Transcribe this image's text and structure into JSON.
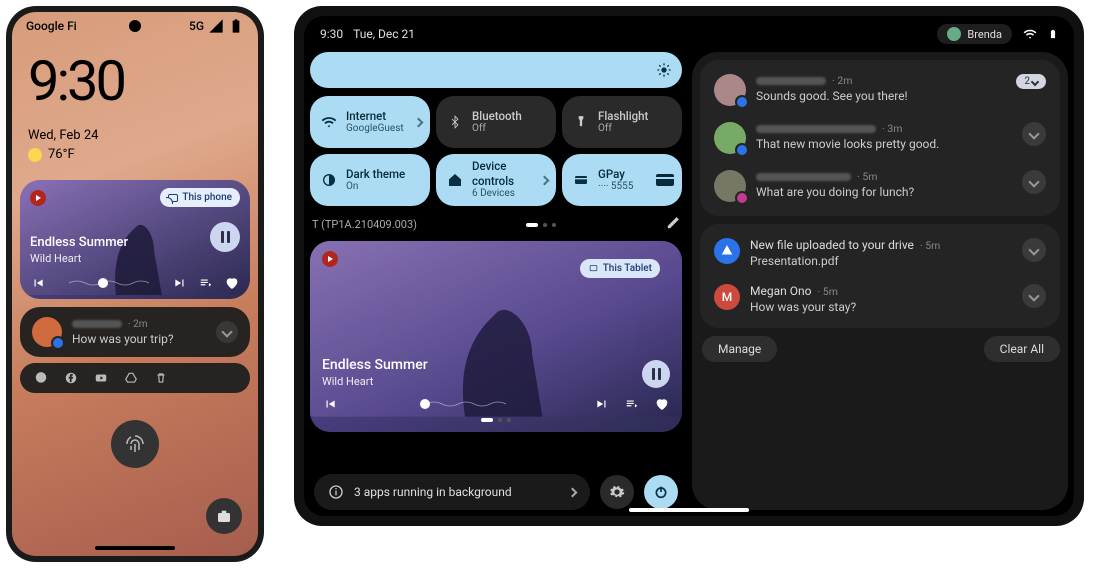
{
  "phone": {
    "carrier": "Google Fi",
    "signal": "5G",
    "clock": "9:30",
    "date": "Wed, Feb 24",
    "temp": "76°F",
    "media": {
      "device": "This phone",
      "song": "Endless Summer",
      "artist": "Wild Heart"
    },
    "notif": {
      "time": "2m",
      "body": "How was your trip?"
    }
  },
  "tablet": {
    "time": "9:30",
    "date_label": "Tue, Dec 21",
    "profile": "Brenda",
    "tiles": {
      "internet": {
        "label": "Internet",
        "value": "GoogleGuest"
      },
      "bluetooth": {
        "label": "Bluetooth",
        "value": "Off"
      },
      "flashlight": {
        "label": "Flashlight",
        "value": "Off"
      },
      "dark": {
        "label": "Dark theme",
        "value": "On"
      },
      "devices": {
        "label": "Device controls",
        "value": "6 Devices"
      },
      "gpay": {
        "label": "GPay",
        "value": "···· 5555"
      }
    },
    "build": "T (TP1A.210409.003)",
    "media": {
      "device": "This Tablet",
      "song": "Endless Summer",
      "artist": "Wild Heart"
    },
    "running": "3 apps running in background",
    "notifs": [
      {
        "time": "2m",
        "body": "Sounds good. See you there!",
        "count": "2"
      },
      {
        "time": "3m",
        "body": "That new movie looks pretty good."
      },
      {
        "time": "5m",
        "body": "What are you doing for lunch?"
      }
    ],
    "notifs2": [
      {
        "title": "New file uploaded to your drive",
        "time": "5m",
        "body": "Presentation.pdf"
      },
      {
        "title": "Megan Ono",
        "time": "5m",
        "body": "How was your stay?"
      }
    ],
    "manage": "Manage",
    "clear": "Clear All"
  }
}
